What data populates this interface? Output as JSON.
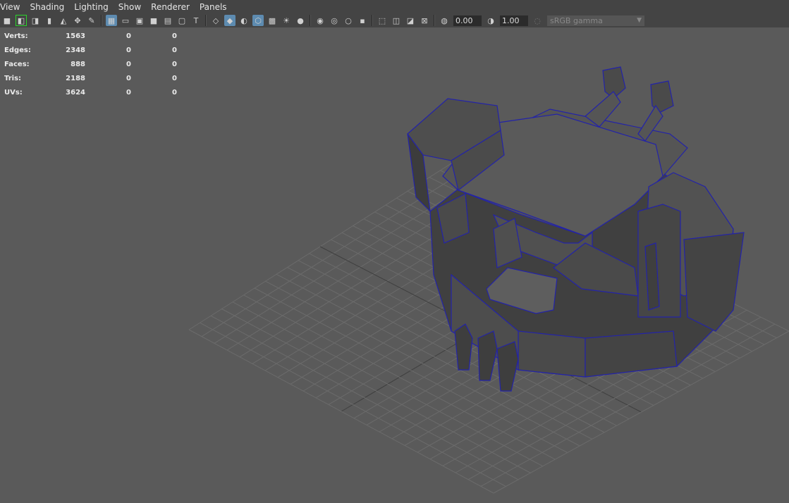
{
  "menu": [
    "View",
    "Shading",
    "Lighting",
    "Show",
    "Renderer",
    "Panels"
  ],
  "toolbar": {
    "icons": [
      "camera-icon",
      "select-camera-icon",
      "camera-attr-icon",
      "bookmark-icon",
      "image-plane-icon",
      "2d-pan-icon",
      "grease-pencil-icon",
      "grid-icon",
      "film-gate-icon",
      "resolution-gate-icon",
      "gate-mask-icon",
      "field-chart-icon",
      "safe-action-icon",
      "safe-title-icon",
      "wireframe-icon",
      "smooth-shade-icon",
      "default-material-icon",
      "wireframe-on-shaded-icon",
      "textured-icon",
      "use-all-lights-icon",
      "shadows-icon",
      "screen-space-ao-icon",
      "motion-blur-icon",
      "multisample-aa-icon",
      "depth-of-field-icon",
      "isolate-select-icon",
      "xray-icon",
      "xray-active-icon",
      "xray-joints-icon",
      "exposure-icon"
    ],
    "exposure_value": "0.00",
    "gamma_icon": "gamma-icon",
    "gamma_value": "1.00",
    "color_space": "sRGB gamma"
  },
  "hud": {
    "rows": [
      {
        "label": "Verts:",
        "v1": "1563",
        "v2": "0",
        "v3": "0"
      },
      {
        "label": "Edges:",
        "v1": "2348",
        "v2": "0",
        "v3": "0"
      },
      {
        "label": "Faces:",
        "v1": "888",
        "v2": "0",
        "v3": "0"
      },
      {
        "label": "Tris:",
        "v1": "2188",
        "v2": "0",
        "v3": "0"
      },
      {
        "label": "UVs:",
        "v1": "3624",
        "v2": "0",
        "v3": "0"
      }
    ]
  },
  "colors": {
    "background": "#5a5a5a",
    "grid": "#6b6b6b",
    "mesh_face": "#474747",
    "mesh_edge": "#2323a8",
    "toolbar": "#444444",
    "active_icon": "#5d8bb0"
  }
}
